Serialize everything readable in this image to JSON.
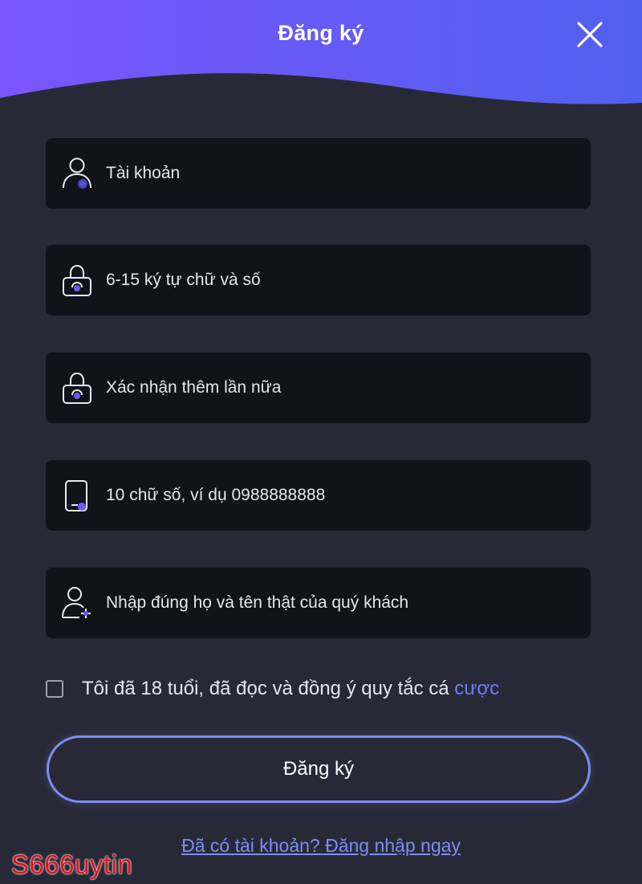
{
  "header": {
    "title": "Đăng ký",
    "gradient_start": "#7b55ff",
    "gradient_end": "#5060ec"
  },
  "close": {
    "icon": "close-icon"
  },
  "form": {
    "fields": [
      {
        "icon": "user-icon",
        "placeholder": "Tài khoản",
        "value": ""
      },
      {
        "icon": "lock-icon",
        "placeholder": "6-15 ký tự chữ và số",
        "value": ""
      },
      {
        "icon": "lock-icon",
        "placeholder": "Xác nhận thêm lần nữa",
        "value": ""
      },
      {
        "icon": "phone-icon",
        "placeholder": "10 chữ số, ví dụ 0988888888",
        "value": ""
      },
      {
        "icon": "add-user-icon",
        "placeholder": "Nhập đúng họ và tên thật của quý khách",
        "value": ""
      }
    ]
  },
  "agreement": {
    "checked": false,
    "text": "Tôi đã 18 tuổi, đã đọc và đồng ý quy tắc cá ",
    "link": "cược"
  },
  "submit": {
    "label": "Đăng ký"
  },
  "login_link": "Đã có tài khoản? Đăng nhập ngay",
  "watermark": "S666uytin",
  "colors": {
    "background": "#272a36",
    "field_background": "#11131a",
    "accent": "#7e8cf4",
    "link": "#6f7bff",
    "watermark": "#e0101e"
  }
}
